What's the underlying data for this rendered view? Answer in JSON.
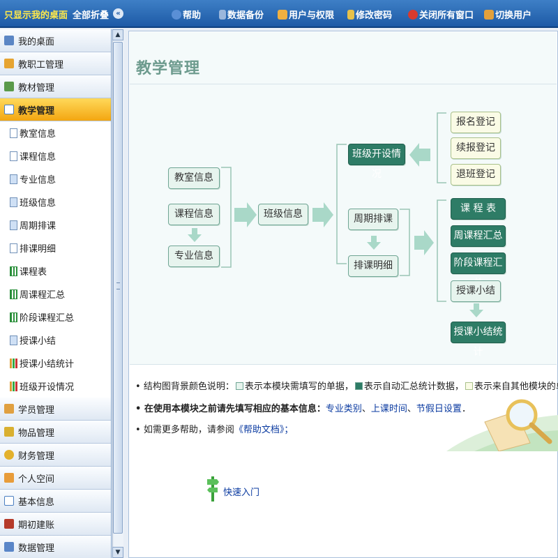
{
  "topbar": {
    "only_desktop": "只显示我的桌面",
    "fold_all": "全部折叠",
    "items": [
      "帮助",
      "数据备份",
      "用户与权限",
      "修改密码",
      "关闭所有窗口",
      "切换用户"
    ]
  },
  "sidebar": {
    "items": [
      {
        "label": "我的桌面"
      },
      {
        "label": "教职工管理"
      },
      {
        "label": "教材管理"
      },
      {
        "label": "教学管理"
      }
    ],
    "sub_items": [
      "教室信息",
      "课程信息",
      "专业信息",
      "班级信息",
      "周期排课",
      "排课明细",
      "课程表",
      "周课程汇总",
      "阶段课程汇总",
      "授课小结",
      "授课小结统计",
      "班级开设情况"
    ],
    "items_after": [
      {
        "label": "学员管理"
      },
      {
        "label": "物品管理"
      },
      {
        "label": "财务管理"
      },
      {
        "label": "个人空间"
      },
      {
        "label": "基本信息"
      },
      {
        "label": "期初建账"
      },
      {
        "label": "数据管理"
      }
    ]
  },
  "main": {
    "title": "教学管理",
    "flow": {
      "classroom": "教室信息",
      "course": "课程信息",
      "major": "专业信息",
      "class_info": "班级信息",
      "class_open": "班级开设情况",
      "period_sched": "周期排课",
      "sched_detail": "排课明细",
      "signup": "报名登记",
      "renew": "续报登记",
      "withdraw": "退班登记",
      "timetable": "课 程 表",
      "week_summary": "周课程汇总",
      "stage_summary": "阶段课程汇总",
      "lesson_summary": "授课小结",
      "lesson_stats": "授课小结统计"
    },
    "legend": {
      "line1_prefix": "结构图背景颜色说明：",
      "line1_a": "表示本模块需填写的单据，",
      "line1_b": "表示自动汇总统计数据，",
      "line1_c": "表示来自其他模块的单据．",
      "line2_prefix": "在使用本模块之前请先填写相应的基本信息：",
      "link_major": "专业类别",
      "sep1": "、",
      "link_time": "上课时间",
      "sep2": "、",
      "link_holiday": "节假日设置",
      "line2_end": "．",
      "line3_prefix": "如需更多帮助，请参阅",
      "link_help": "《帮助文档》；"
    },
    "quickstart": "快速入门"
  }
}
